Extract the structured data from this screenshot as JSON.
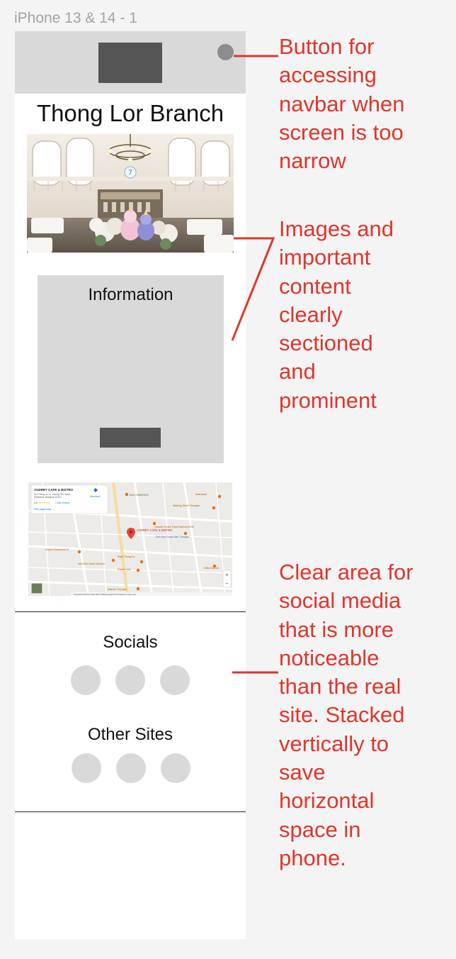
{
  "frame": {
    "label": "iPhone 13 & 14 - 1"
  },
  "page": {
    "title": "Thong Lor Branch",
    "info": {
      "title": "Information"
    },
    "socials": {
      "title": "Socials",
      "count": 3
    },
    "other_sites": {
      "title": "Other Sites",
      "count": 3
    }
  },
  "map": {
    "place_name": "AUDREY CAFE & BISTRO",
    "address_line1": "Soi Thong Lo 11, Khlong Tan Nuea,",
    "address_line2": "Watthana, Bangkok 10110",
    "rating": "4.2",
    "stars": "★★★★★",
    "reviews": "1,044 reviews",
    "directions": "Directions",
    "larger_map": "View larger map",
    "pin_label": "AUDREY CAFE & BISTRO",
    "labels": {
      "commons": "theCOMMONS",
      "atarwadi": "Atarwadi",
      "walking_street": "Walking Street Thonglor",
      "grande_centre": "Grande Centre Point Sukhumvit 55",
      "donki": "Don Don Donki Mall Thonglor",
      "kuyas": "Kuya's Sukhumvit 49",
      "helena": "HELENA Greek Kitchen",
      "eight_thonglor": "Eight Thong Lo",
      "rabbit_hole": "Rabbit Hole",
      "marche": "Marché Thonglor",
      "hello_kitchen": "Hello Kitchen"
    },
    "zoom_in": "+",
    "zoom_out": "−",
    "footer": "Keyboard shortcuts   Map data ©2024 Google   Terms   Report a map error"
  },
  "annotations": {
    "nav": "Button for\naccessing\nnavbar when\nscreen is too\nnarrow",
    "content": "Images and\nimportant\ncontent\nclearly\nsectioned\nand\nprominent",
    "social": "Clear area for\nsocial media\nthat is more\nnoticeable\nthan the real\nsite. Stacked\nvertically to\nsave\nhorizontal\nspace in\nphone."
  },
  "colors": {
    "annotation": "#e0352b",
    "placeholder": "#d9d9d9",
    "dark_block": "#555555",
    "background": "#f4f4f4"
  }
}
